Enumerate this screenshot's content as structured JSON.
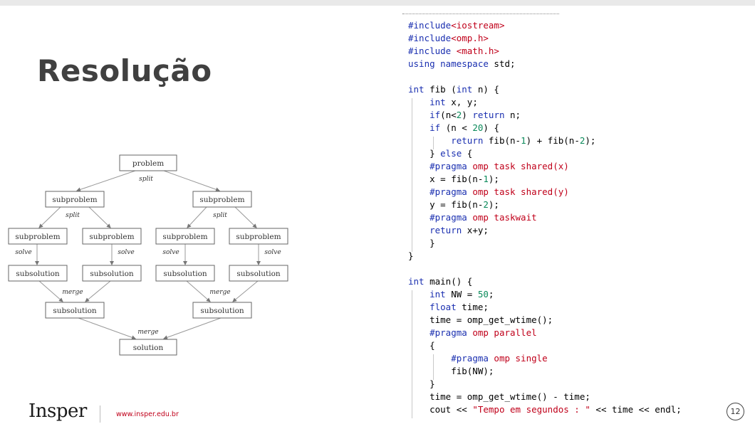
{
  "slide": {
    "title": "Resolução",
    "footer": {
      "logo": "Insper",
      "url": "www.insper.edu.br",
      "page_number": "12"
    }
  },
  "diagram": {
    "nodes": {
      "root": "problem",
      "sub_l": "subproblem",
      "sub_r": "subproblem",
      "sub_ll": "subproblem",
      "sub_lr": "subproblem",
      "sub_rl": "subproblem",
      "sub_rr": "subproblem",
      "sol_ll": "subsolution",
      "sol_lr": "subsolution",
      "sol_rl": "subsolution",
      "sol_rr": "subsolution",
      "sol_l": "subsolution",
      "sol_r": "subsolution",
      "final": "solution"
    },
    "labels": {
      "split_top": "split",
      "split_left": "split",
      "split_right": "split",
      "solve_1": "solve",
      "solve_2": "solve",
      "solve_3": "solve",
      "solve_4": "solve",
      "merge_left": "merge",
      "merge_right": "merge",
      "merge_bottom": "merge"
    }
  },
  "code": {
    "lines": [
      [
        {
          "t": "#include",
          "c": "kw"
        },
        {
          "t": "<iostream>",
          "c": "inc"
        }
      ],
      [
        {
          "t": "#include",
          "c": "kw"
        },
        {
          "t": "<omp.h>",
          "c": "inc"
        }
      ],
      [
        {
          "t": "#include ",
          "c": "kw"
        },
        {
          "t": "<math.h>",
          "c": "inc"
        }
      ],
      [
        {
          "t": "using namespace",
          "c": "kw"
        },
        {
          "t": " std;",
          "c": ""
        }
      ],
      [],
      [
        {
          "t": "int",
          "c": "kw"
        },
        {
          "t": " fib (",
          "c": ""
        },
        {
          "t": "int",
          "c": "kw"
        },
        {
          "t": " n) {",
          "c": ""
        }
      ],
      [
        {
          "t": "    ",
          "c": ""
        },
        {
          "t": "int",
          "c": "kw"
        },
        {
          "t": " x, y;",
          "c": ""
        }
      ],
      [
        {
          "t": "    ",
          "c": ""
        },
        {
          "t": "if",
          "c": "kw"
        },
        {
          "t": "(n<",
          "c": ""
        },
        {
          "t": "2",
          "c": "num"
        },
        {
          "t": ") ",
          "c": ""
        },
        {
          "t": "return",
          "c": "kw"
        },
        {
          "t": " n;",
          "c": ""
        }
      ],
      [
        {
          "t": "    ",
          "c": ""
        },
        {
          "t": "if",
          "c": "kw"
        },
        {
          "t": " (n < ",
          "c": ""
        },
        {
          "t": "20",
          "c": "num"
        },
        {
          "t": ") {",
          "c": ""
        }
      ],
      [
        {
          "t": "        ",
          "c": ""
        },
        {
          "t": "return",
          "c": "kw"
        },
        {
          "t": " fib(n-",
          "c": ""
        },
        {
          "t": "1",
          "c": "num"
        },
        {
          "t": ") + fib(n-",
          "c": ""
        },
        {
          "t": "2",
          "c": "num"
        },
        {
          "t": ");",
          "c": ""
        }
      ],
      [
        {
          "t": "    } ",
          "c": ""
        },
        {
          "t": "else",
          "c": "kw"
        },
        {
          "t": " {",
          "c": ""
        }
      ],
      [
        {
          "t": "    ",
          "c": ""
        },
        {
          "t": "#pragma",
          "c": "kw"
        },
        {
          "t": " omp task shared(x)",
          "c": "inc"
        }
      ],
      [
        {
          "t": "    x = fib(n-",
          "c": ""
        },
        {
          "t": "1",
          "c": "num"
        },
        {
          "t": ");",
          "c": ""
        }
      ],
      [
        {
          "t": "    ",
          "c": ""
        },
        {
          "t": "#pragma",
          "c": "kw"
        },
        {
          "t": " omp task shared(y)",
          "c": "inc"
        }
      ],
      [
        {
          "t": "    y = fib(n-",
          "c": ""
        },
        {
          "t": "2",
          "c": "num"
        },
        {
          "t": ");",
          "c": ""
        }
      ],
      [
        {
          "t": "    ",
          "c": ""
        },
        {
          "t": "#pragma",
          "c": "kw"
        },
        {
          "t": " omp taskwait",
          "c": "inc"
        }
      ],
      [
        {
          "t": "    ",
          "c": ""
        },
        {
          "t": "return",
          "c": "kw"
        },
        {
          "t": " x+y;",
          "c": ""
        }
      ],
      [
        {
          "t": "    }",
          "c": ""
        }
      ],
      [
        {
          "t": "}",
          "c": ""
        }
      ],
      [],
      [
        {
          "t": "int",
          "c": "kw"
        },
        {
          "t": " main() {",
          "c": ""
        }
      ],
      [
        {
          "t": "    ",
          "c": ""
        },
        {
          "t": "int",
          "c": "kw"
        },
        {
          "t": " NW = ",
          "c": ""
        },
        {
          "t": "50",
          "c": "num"
        },
        {
          "t": ";",
          "c": ""
        }
      ],
      [
        {
          "t": "    ",
          "c": ""
        },
        {
          "t": "float",
          "c": "kw"
        },
        {
          "t": " time;",
          "c": ""
        }
      ],
      [
        {
          "t": "    time = omp_get_wtime();",
          "c": ""
        }
      ],
      [
        {
          "t": "    ",
          "c": ""
        },
        {
          "t": "#pragma",
          "c": "kw"
        },
        {
          "t": " omp parallel",
          "c": "inc"
        }
      ],
      [
        {
          "t": "    {",
          "c": ""
        }
      ],
      [
        {
          "t": "        ",
          "c": ""
        },
        {
          "t": "#pragma",
          "c": "kw"
        },
        {
          "t": " omp single",
          "c": "inc"
        }
      ],
      [
        {
          "t": "        fib(NW);",
          "c": ""
        }
      ],
      [
        {
          "t": "    }",
          "c": ""
        }
      ],
      [
        {
          "t": "    time = omp_get_wtime() - time;",
          "c": ""
        }
      ],
      [
        {
          "t": "    cout << ",
          "c": ""
        },
        {
          "t": "\"Tempo em segundos : \"",
          "c": "str"
        },
        {
          "t": " << time << endl;",
          "c": ""
        }
      ]
    ]
  },
  "colors": {
    "keyword": "#1a2fb0",
    "directive": "#c0001a",
    "number": "#0a8a5a",
    "title": "#404040",
    "url": "#c0001a"
  }
}
